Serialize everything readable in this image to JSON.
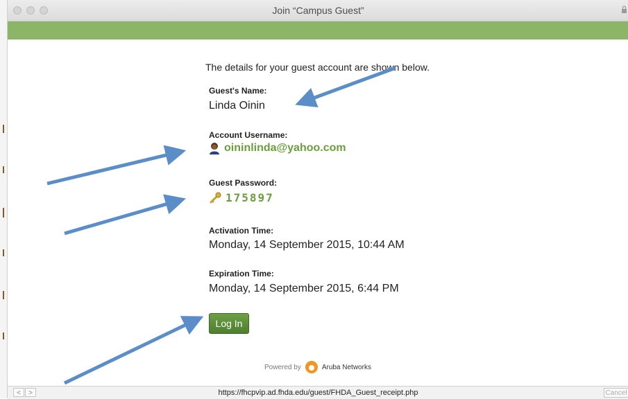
{
  "window": {
    "title": "Join “Campus Guest”"
  },
  "receipt": {
    "intro": "The details for your guest account are shown below.",
    "guest_name_label": "Guest's Name:",
    "guest_name": "Linda Oinin",
    "username_label": "Account Username:",
    "username": "oininlinda@yahoo.com",
    "password_label": "Guest Password:",
    "password": "175897",
    "activation_label": "Activation Time:",
    "activation": "Monday, 14 September 2015, 10:44 AM",
    "expiration_label": "Expiration Time:",
    "expiration": "Monday, 14 September 2015, 6:44 PM",
    "login_label": "Log In",
    "powered_by": "Powered by",
    "brand": "Aruba Networks"
  },
  "statusbar": {
    "back": "<",
    "forward": ">",
    "url": "https://fhcpvip.ad.fhda.edu/guest/FHDA_Guest_receipt.php",
    "cancel_label": "Cancel"
  },
  "colors": {
    "header_bar": "#8db567",
    "accent_green": "#6c9e3e",
    "button_green": "#5d8f3a",
    "annotation_arrow": "#5b8ec8",
    "aruba_orange": "#f29521"
  },
  "icons": {
    "username": "user-avatar-icon",
    "password": "key-icon",
    "brand": "aruba-logo-icon",
    "titlebar_right": "lock-icon"
  }
}
